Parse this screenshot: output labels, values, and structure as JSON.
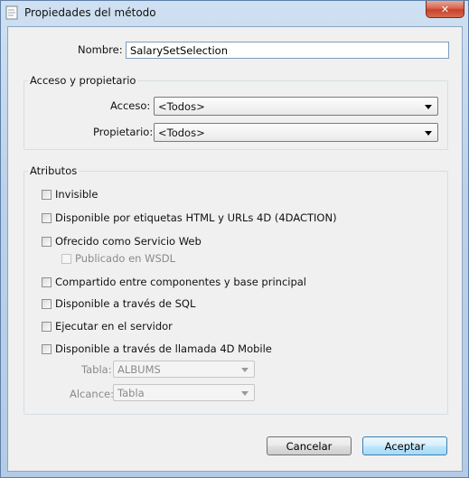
{
  "window": {
    "title": "Propiedades del método",
    "close_symbol": "✕"
  },
  "name_field": {
    "label": "Nombre:",
    "value": "SalarySetSelection"
  },
  "access_group": {
    "title": "Acceso y propietario",
    "access": {
      "label": "Acceso:",
      "value": "<Todos>"
    },
    "owner": {
      "label": "Propietario:",
      "value": "<Todos>"
    }
  },
  "attributes_group": {
    "title": "Atributos",
    "items": [
      {
        "label": "Invisible",
        "checked": false
      },
      {
        "label": "Disponible por etiquetas HTML y URLs 4D (4DACTION)",
        "checked": false
      },
      {
        "label": "Ofrecido como Servicio Web",
        "checked": false
      },
      {
        "label": "Publicado en WSDL",
        "checked": false,
        "disabled": true
      },
      {
        "label": "Compartido entre componentes y base principal",
        "checked": false
      },
      {
        "label": "Disponible a través de SQL",
        "checked": false
      },
      {
        "label": "Ejecutar en el servidor",
        "checked": false
      },
      {
        "label": "Disponible a través de llamada 4D Mobile",
        "checked": false
      }
    ],
    "table": {
      "label": "Tabla:",
      "value": "ALBUMS"
    },
    "scope": {
      "label": "Alcance:",
      "value": "Tabla"
    }
  },
  "buttons": {
    "cancel": "Cancelar",
    "accept": "Aceptar"
  }
}
